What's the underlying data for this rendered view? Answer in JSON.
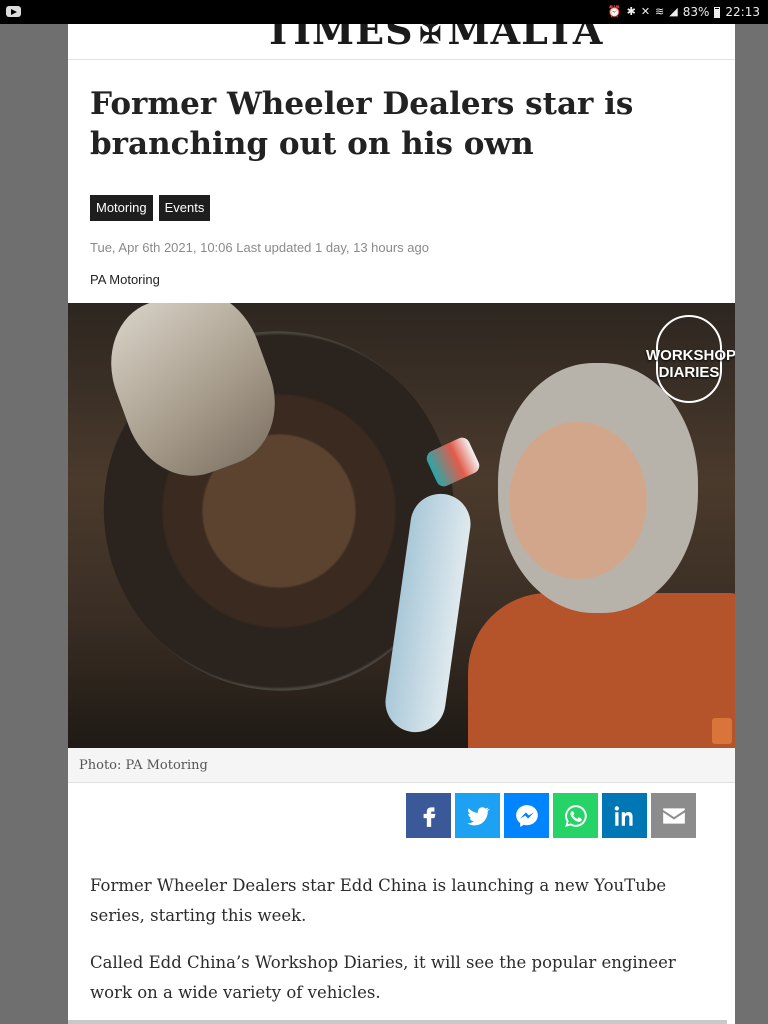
{
  "status_bar": {
    "battery": "83%",
    "time": "22:13"
  },
  "masthead": {
    "logo_left": "TIMES",
    "logo_right": "MALTA"
  },
  "article": {
    "title": "Former Wheeler Dealers star is branching out on his own",
    "tags": [
      "Motoring",
      "Events"
    ],
    "dateline": "Tue, Apr 6th 2021, 10:06 Last updated 1 day, 13 hours ago",
    "byline": "PA Motoring",
    "photo_badge": "WORKSHOP DIARIES",
    "caption": "Photo: PA Motoring",
    "paragraphs": [
      "Former Wheeler Dealers star Edd China is launching a new YouTube series, starting this week.",
      "Called Edd China’s Workshop Diaries, it will see the popular engineer work on a wide variety of vehicles."
    ]
  },
  "share": [
    {
      "name": "facebook",
      "color": "#3b5998"
    },
    {
      "name": "twitter",
      "color": "#1da1f2"
    },
    {
      "name": "messenger",
      "color": "#0084ff"
    },
    {
      "name": "whatsapp",
      "color": "#25d366"
    },
    {
      "name": "linkedin",
      "color": "#0077b5"
    },
    {
      "name": "email",
      "color": "#8c8c8c"
    }
  ]
}
